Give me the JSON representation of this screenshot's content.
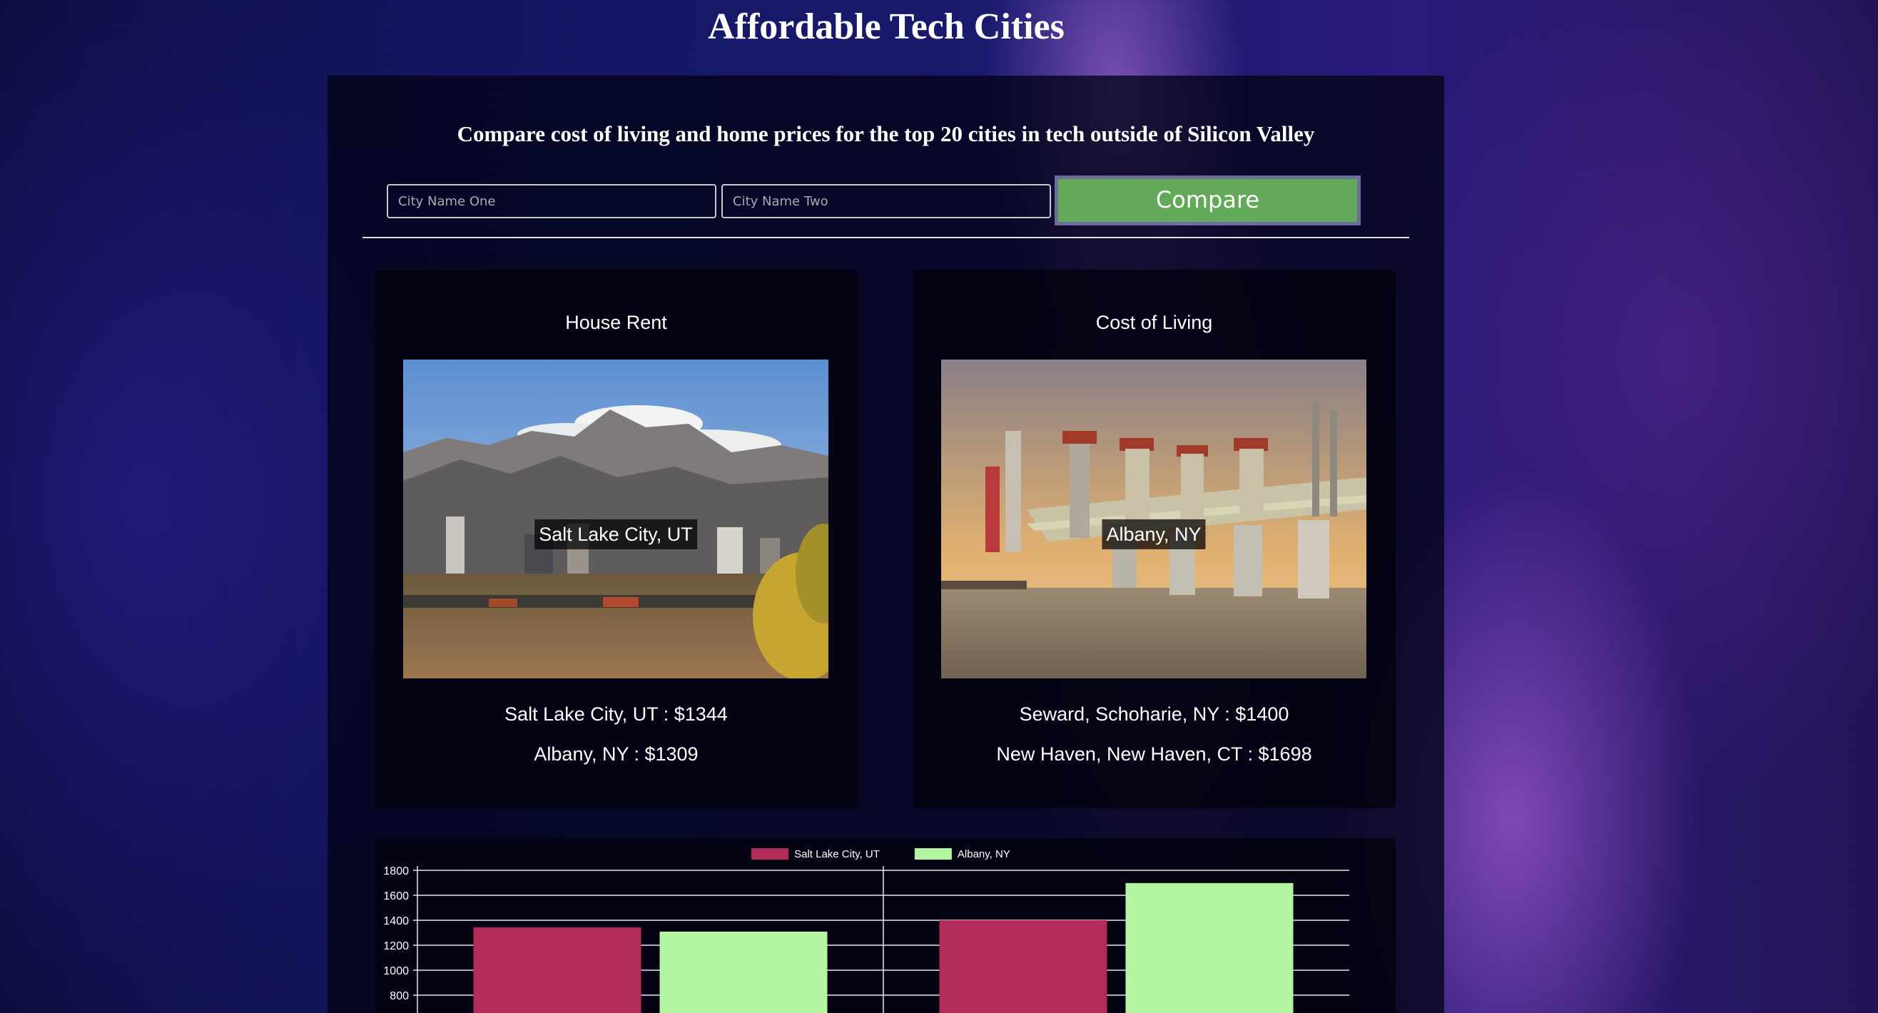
{
  "header": {
    "title": "Affordable Tech Cities"
  },
  "main": {
    "subtitle": "Compare cost of living and home prices for the top 20 cities in tech outside of Silicon Valley"
  },
  "search": {
    "city_one_placeholder": "City Name One",
    "city_one_value": "",
    "city_two_placeholder": "City Name Two",
    "city_two_value": "",
    "compare_label": "Compare",
    "compare_color": "#62a95a"
  },
  "cards": {
    "house_rent": {
      "heading": "House Rent",
      "image_label": "Salt Lake City, UT",
      "line_1": "Salt Lake City, UT : $1344",
      "line_2": "Albany, NY : $1309"
    },
    "cost_of_living": {
      "heading": "Cost of Living",
      "image_label": "Albany, NY",
      "line_1": "Seward, Schoharie, NY : $1400",
      "line_2": "New Haven, New Haven, CT : $1698"
    }
  },
  "chart_data": {
    "type": "bar",
    "categories": [
      "",
      ""
    ],
    "series": [
      {
        "name": "Salt Lake City, UT",
        "values": [
          1344,
          1400
        ],
        "color": "#b22b59"
      },
      {
        "name": "Albany, NY",
        "values": [
          1309,
          1698
        ],
        "color": "#b3f5a2"
      }
    ],
    "y_ticks": [
      "1800",
      "1600",
      "1400",
      "1200",
      "1000",
      "800"
    ],
    "ylim": [
      0,
      1800
    ],
    "grid": true,
    "legend": "top-center"
  }
}
